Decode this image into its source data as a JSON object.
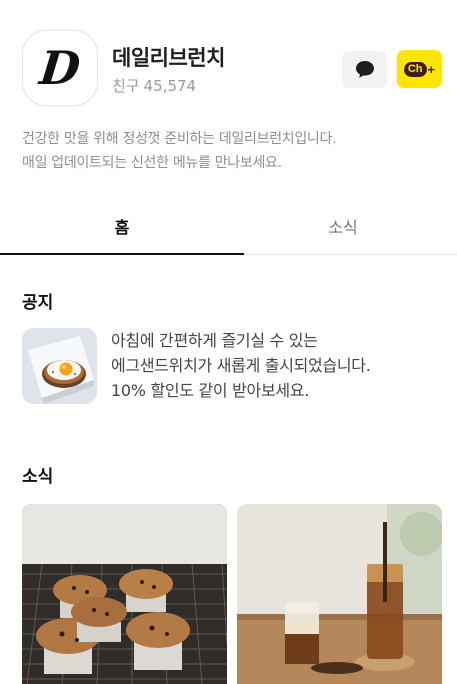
{
  "profile": {
    "logo_letter": "D",
    "name": "데일리브런치",
    "friends_label": "친구",
    "friends_count": "45,574"
  },
  "actions": {
    "chat_icon": "speech-bubble-icon",
    "channel_add_label": "Ch",
    "channel_add_plus": "+"
  },
  "description": [
    "건강한 맛을 위해 정성껏 준비하는 데일리브런치입니다.",
    "매일 업데이트되는 신선한 메뉴를 만나보세요."
  ],
  "tabs": [
    {
      "label": "홈",
      "active": true
    },
    {
      "label": "소식",
      "active": false
    }
  ],
  "notice": {
    "title": "공지",
    "lines": [
      "아침에 간편하게 즐기실 수 있는",
      "에그샌드위치가 새롭게 출시되었습니다.",
      "10% 할인도 같이 받아보세요."
    ]
  },
  "news": {
    "title": "소식"
  },
  "colors": {
    "accent_yellow": "#fee500",
    "text_primary": "#111111",
    "text_muted": "#8e8e8e"
  }
}
